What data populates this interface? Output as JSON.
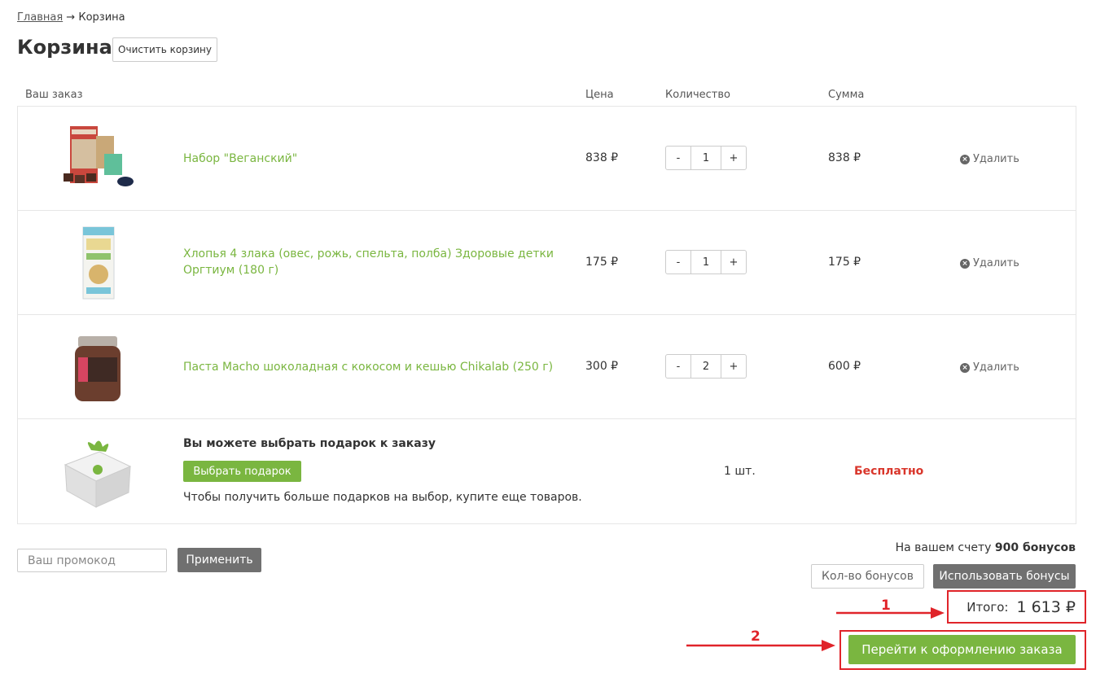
{
  "breadcrumb": {
    "home": "Главная",
    "sep": "→",
    "current": "Корзина"
  },
  "page_title": "Корзина",
  "clear_cart": "Очистить корзину",
  "columns": {
    "order": "Ваш заказ",
    "price": "Цена",
    "quantity": "Количество",
    "sum": "Сумма"
  },
  "items": [
    {
      "name": "Набор \"Веганский\"",
      "price": "838 ₽",
      "qty": "1",
      "sum": "838 ₽",
      "delete": "Удалить"
    },
    {
      "name": "Хлопья 4 злака (овес, рожь, спельта, полба) Здоровые детки Оргтиум (180 г)",
      "price": "175 ₽",
      "qty": "1",
      "sum": "175 ₽",
      "delete": "Удалить"
    },
    {
      "name": "Паста Macho шоколадная с кокосом и кешью Chikalab (250 г)",
      "price": "300 ₽",
      "qty": "2",
      "sum": "600 ₽",
      "delete": "Удалить"
    }
  ],
  "qty_minus": "-",
  "qty_plus": "+",
  "gift": {
    "title": "Вы можете выбрать подарок к заказу",
    "button": "Выбрать подарок",
    "note": "Чтобы получить больше подарков на выбор, купите еще товаров.",
    "qty": "1 шт.",
    "price": "Бесплатно"
  },
  "promo": {
    "placeholder": "Ваш промокод",
    "apply": "Применить"
  },
  "bonus": {
    "info_prefix": "На вашем счету",
    "info_amount": "900 бонусов",
    "input_placeholder": "Кол-во бонусов",
    "use_button": "Использовать бонусы"
  },
  "total": {
    "label": "Итого:",
    "value": "1 613 ₽"
  },
  "checkout": "Перейти к оформлению заказа",
  "annotations": {
    "one": "1",
    "two": "2"
  },
  "colors": {
    "accent_green": "#7ab640",
    "annotation_red": "#e0242a",
    "button_gray": "#707070"
  },
  "icons": [
    "delete-icon",
    "veg-set-image",
    "cereal-box-image",
    "macho-jar-image",
    "gift-box-image"
  ]
}
